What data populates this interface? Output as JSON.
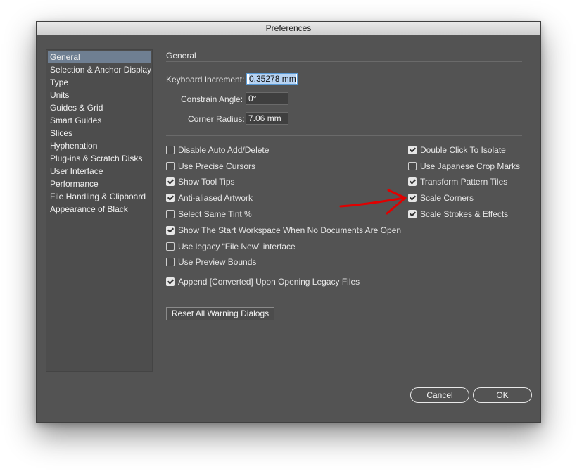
{
  "window": {
    "title": "Preferences"
  },
  "sidebar": {
    "items": [
      {
        "label": "General",
        "selected": true
      },
      {
        "label": "Selection & Anchor Display"
      },
      {
        "label": "Type"
      },
      {
        "label": "Units"
      },
      {
        "label": "Guides & Grid"
      },
      {
        "label": "Smart Guides"
      },
      {
        "label": "Slices"
      },
      {
        "label": "Hyphenation"
      },
      {
        "label": "Plug-ins & Scratch Disks"
      },
      {
        "label": "User Interface"
      },
      {
        "label": "Performance"
      },
      {
        "label": "File Handling & Clipboard"
      },
      {
        "label": "Appearance of Black"
      }
    ]
  },
  "general": {
    "title": "General",
    "keyboard_increment": {
      "label": "Keyboard Increment:",
      "value": "0.35278 mm"
    },
    "constrain_angle": {
      "label": "Constrain Angle:",
      "value": "0°"
    },
    "corner_radius": {
      "label": "Corner Radius:",
      "value": "7.06 mm"
    }
  },
  "options": {
    "left": [
      {
        "label": "Disable Auto Add/Delete",
        "checked": false
      },
      {
        "label": "Use Precise Cursors",
        "checked": false
      },
      {
        "label": "Show Tool Tips",
        "checked": true
      },
      {
        "label": "Anti-aliased Artwork",
        "checked": true
      },
      {
        "label": "Select Same Tint %",
        "checked": false
      },
      {
        "label": "Show The Start Workspace When No Documents Are Open",
        "checked": true
      },
      {
        "label": "Use legacy “File New” interface",
        "checked": false
      },
      {
        "label": "Use Preview Bounds",
        "checked": false
      },
      {
        "label": "Append [Converted] Upon Opening Legacy Files",
        "checked": true
      }
    ],
    "right": [
      {
        "label": "Double Click To Isolate",
        "checked": true
      },
      {
        "label": "Use Japanese Crop Marks",
        "checked": false
      },
      {
        "label": "Transform Pattern Tiles",
        "checked": true
      },
      {
        "label": "Scale Corners",
        "checked": true
      },
      {
        "label": "Scale Strokes & Effects",
        "checked": true
      }
    ]
  },
  "buttons": {
    "reset_warnings": "Reset All Warning Dialogs",
    "cancel": "Cancel",
    "ok": "OK"
  },
  "colors": {
    "dialog_bg": "#535353",
    "selection": "#6f7f92",
    "annotation_arrow": "#e00000"
  }
}
